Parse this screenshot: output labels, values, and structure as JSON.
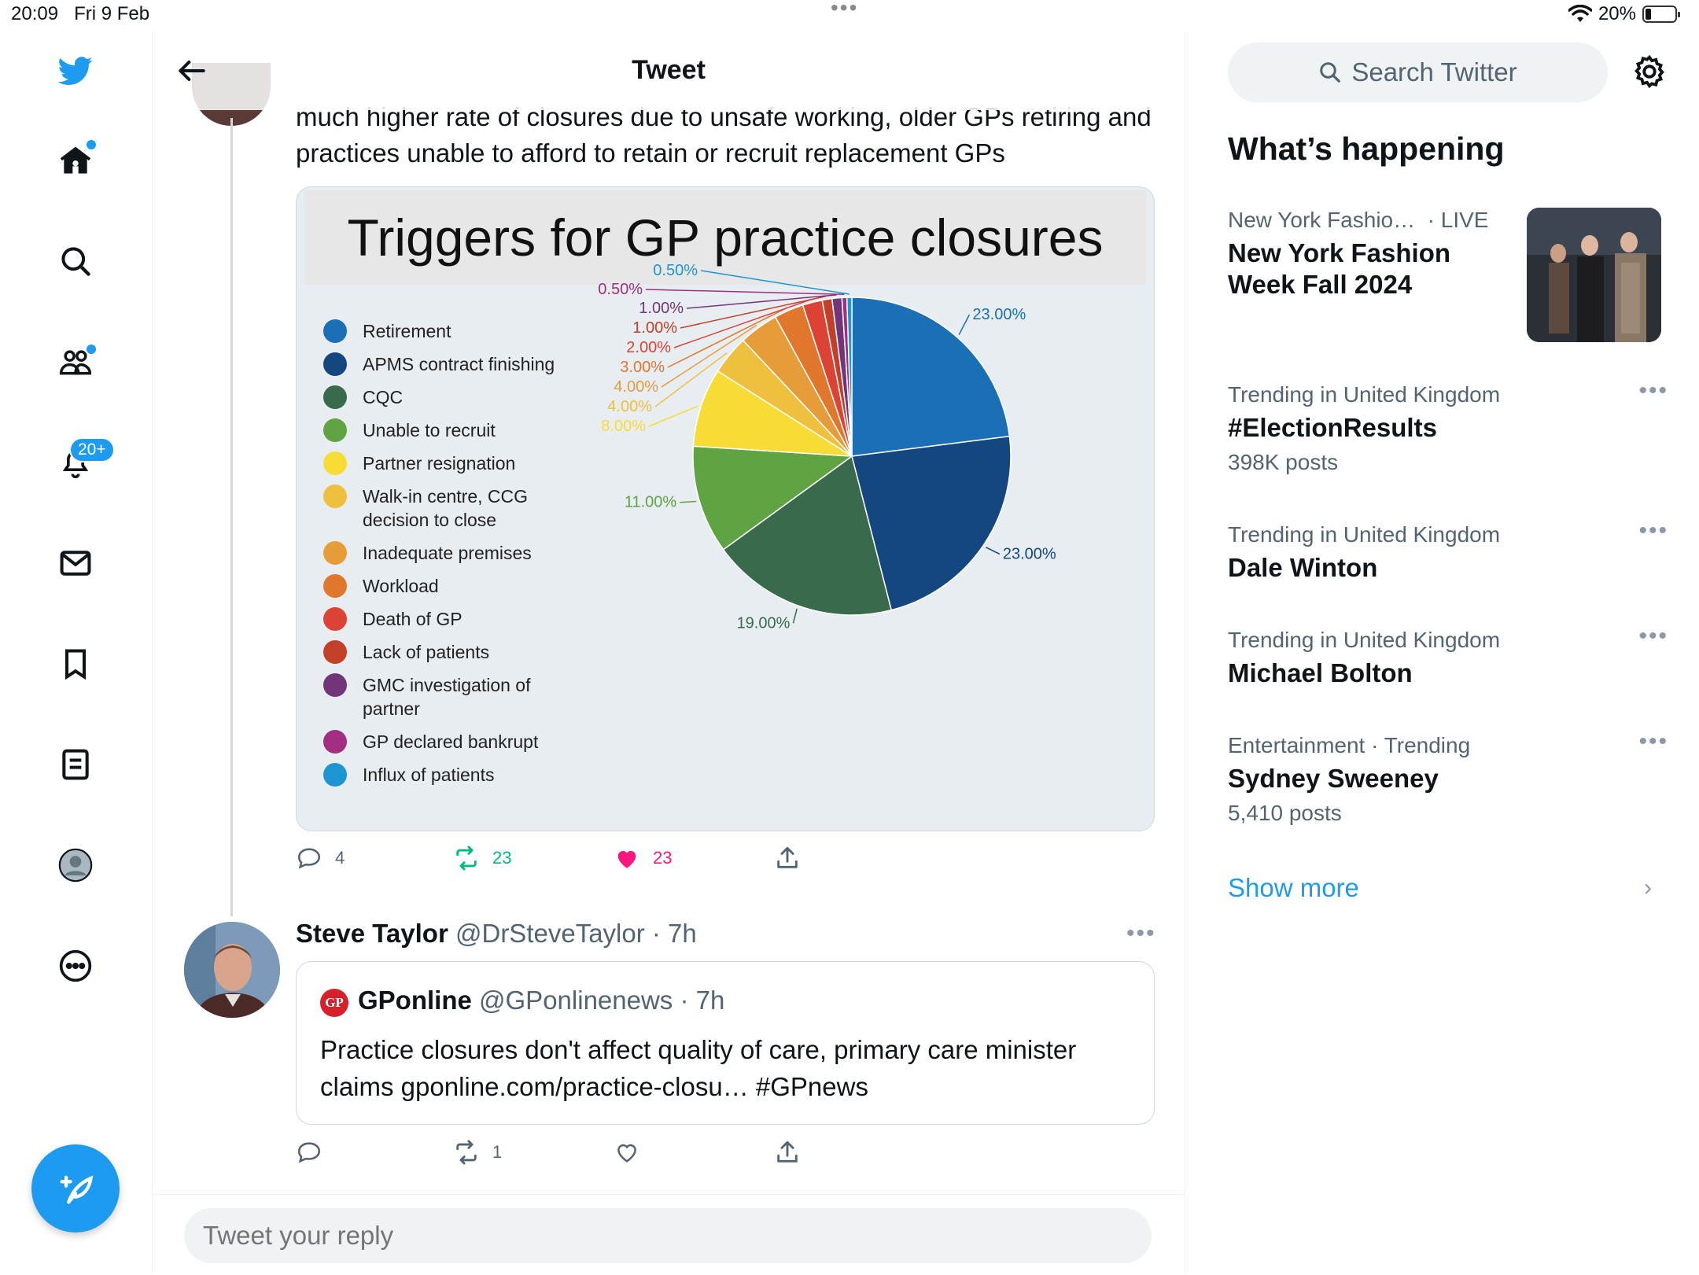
{
  "status_bar": {
    "time": "20:09",
    "date": "Fri 9 Feb",
    "battery": "20%",
    "battery_level": 0.2
  },
  "nav": {
    "items": [
      "twitter-logo",
      "home",
      "explore",
      "communities",
      "notifications",
      "messages",
      "bookmarks",
      "lists",
      "profile",
      "more"
    ],
    "notifications_badge": "20+"
  },
  "header": {
    "title": "Tweet"
  },
  "tweet": {
    "text": "much higher rate of closures due to unsafe working, older GPs retiring and practices unable to afford to retain or recruit replacement GPs",
    "actions": {
      "replies": "4",
      "retweets": "23",
      "likes": "23"
    }
  },
  "chart_data": {
    "type": "pie",
    "title": "Triggers for GP practice closures",
    "slices": [
      {
        "label": "Retirement",
        "value": 23.0,
        "display": "23.00%",
        "color": "#1a6fb5"
      },
      {
        "label": "APMS contract finishing",
        "value": 23.0,
        "display": "23.00%",
        "color": "#14467f"
      },
      {
        "label": "CQC",
        "value": 19.0,
        "display": "19.00%",
        "color": "#386a4b"
      },
      {
        "label": "Unable to recruit",
        "value": 11.0,
        "display": "11.00%",
        "color": "#5fa343"
      },
      {
        "label": "Partner resignation",
        "value": 8.0,
        "display": "8.00%",
        "color": "#f8dc36"
      },
      {
        "label": "Walk-in centre, CCG decision to close",
        "value": 4.0,
        "display": "4.00%",
        "color": "#eec03e"
      },
      {
        "label": "Inadequate premises",
        "value": 4.0,
        "display": "4.00%",
        "color": "#e79c3a"
      },
      {
        "label": "Workload",
        "value": 3.0,
        "display": "3.00%",
        "color": "#e0772d"
      },
      {
        "label": "Death of GP",
        "value": 2.0,
        "display": "2.00%",
        "color": "#dd4334"
      },
      {
        "label": "Lack of patients",
        "value": 1.0,
        "display": "1.00%",
        "color": "#c43f27"
      },
      {
        "label": "GMC investigation of partner",
        "value": 1.0,
        "display": "1.00%",
        "color": "#73357a"
      },
      {
        "label": "GP declared bankrupt",
        "value": 0.5,
        "display": "0.50%",
        "color": "#a12e80"
      },
      {
        "label": "Influx of patients",
        "value": 0.5,
        "display": "0.50%",
        "color": "#1e95d3"
      }
    ]
  },
  "reply": {
    "author_name": "Steve Taylor",
    "author_meta": "@DrSteveTaylor · 7h",
    "quote": {
      "logo": "GP",
      "name": "GPonline",
      "meta": "@GPonlinenews · 7h",
      "text": "Practice closures don't affect quality of care, primary care minister claims gponline.com/practice-closu… #GPnews"
    },
    "actions": {
      "retweets": "1"
    }
  },
  "reply_input": {
    "placeholder": "Tweet your reply"
  },
  "sidebar": {
    "search_placeholder": "Search Twitter",
    "whats_happening": "What’s happening",
    "trends": [
      {
        "context": "New York Fashio…",
        "live": "· LIVE",
        "name": "New York Fashion Week Fall 2024",
        "posts": ""
      },
      {
        "context": "Trending in United Kingdom",
        "name": "#ElectionResults",
        "posts": "398K posts"
      },
      {
        "context": "Trending in United Kingdom",
        "name": "Dale Winton",
        "posts": ""
      },
      {
        "context": "Trending in United Kingdom",
        "name": "Michael Bolton",
        "posts": ""
      },
      {
        "context": "Entertainment · Trending",
        "name": "Sydney Sweeney",
        "posts": "5,410 posts"
      }
    ],
    "show_more": "Show more"
  },
  "colors": {
    "accent": "#1d9bf0",
    "retweet": "#00ba7c",
    "like": "#f91880"
  }
}
